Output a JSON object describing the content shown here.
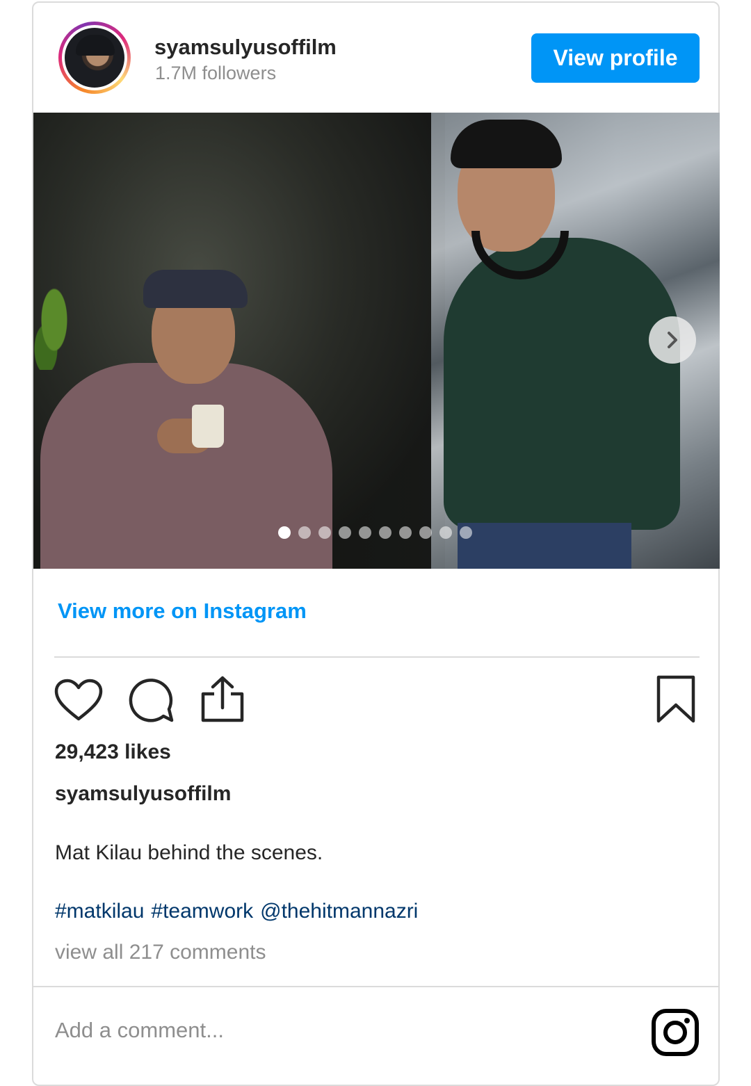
{
  "header": {
    "username": "syamsulyusoffilm",
    "followers": "1.7M followers",
    "view_profile_label": "View profile"
  },
  "media": {
    "carousel_count": 10,
    "active_index": 0
  },
  "footer": {
    "view_more_label": "View more on Instagram",
    "likes": "29,423 likes",
    "caption_username": "syamsulyusoffilm",
    "caption_text": "Mat Kilau behind the scenes.",
    "tags": [
      "#matkilau",
      "#teamwork",
      "@thehitmannazri"
    ],
    "view_all_comments": "view all 217 comments",
    "comment_placeholder": "Add a comment..."
  },
  "icons": {
    "like": "heart-icon",
    "comment": "comment-icon",
    "share": "share-icon",
    "save": "bookmark-icon",
    "logo": "instagram-icon",
    "next": "chevron-right-icon"
  },
  "colors": {
    "primary_blue": "#0095f6",
    "link_dark": "#00376b",
    "muted": "#8e8e8e",
    "text": "#262626",
    "border": "#dbdbdb"
  }
}
